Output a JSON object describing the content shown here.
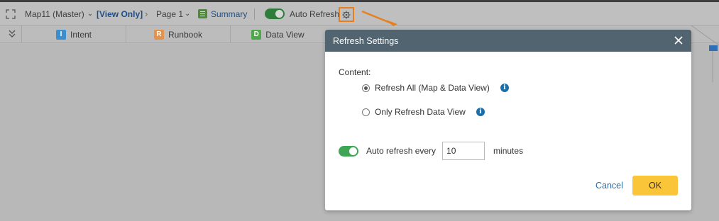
{
  "toolbar": {
    "map_name": "Map11 (Master)",
    "view_only": "[View Only]",
    "page": "Page 1",
    "summary": "Summary",
    "auto_refresh": "Auto Refresh"
  },
  "tabs": [
    {
      "badge": "I",
      "label": "Intent",
      "color": "#3a8fd0"
    },
    {
      "badge": "R",
      "label": "Runbook",
      "color": "#e8914a"
    },
    {
      "badge": "D",
      "label": "Data View",
      "color": "#4fa84a"
    }
  ],
  "dialog": {
    "title": "Refresh Settings",
    "content_label": "Content:",
    "option_all": "Refresh All (Map & Data View)",
    "option_data_view": "Only Refresh Data View",
    "selected_option": "Refresh All (Map & Data View)",
    "auto_refresh_label": "Auto refresh every",
    "auto_refresh_enabled": true,
    "interval_value": "10",
    "minutes_label": "minutes",
    "cancel": "Cancel",
    "ok": "OK"
  },
  "icons": {
    "info": "i"
  },
  "colors": {
    "dialog_header": "#526470",
    "ok_button": "#fbc53a",
    "toggle_on": "#3ea654",
    "highlight": "#e77f1e",
    "link": "#2d6ca6"
  }
}
